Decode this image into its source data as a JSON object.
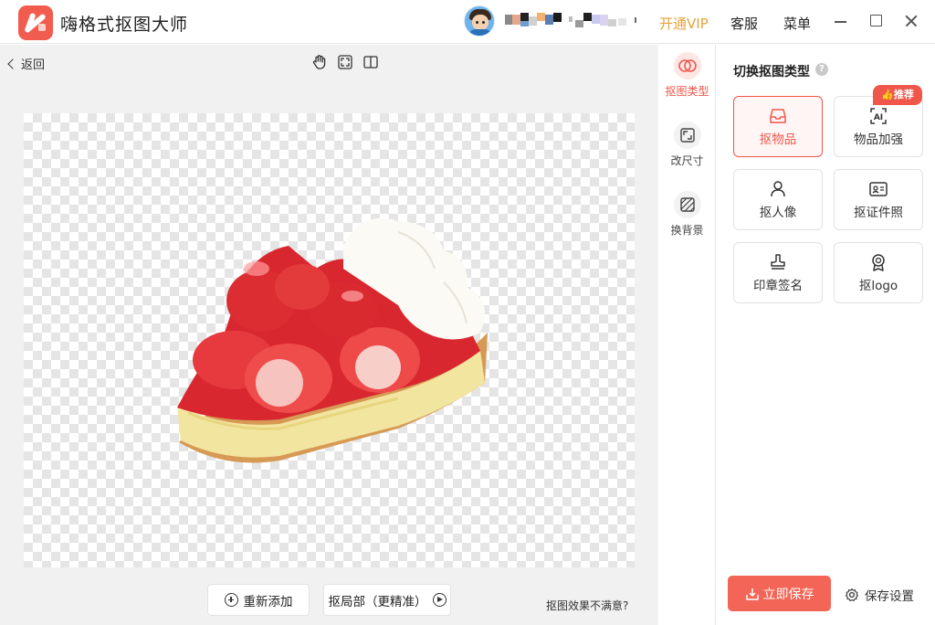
{
  "app": {
    "title": "嗨格式抠图大师"
  },
  "header": {
    "vip_label": "开通VIP",
    "service_label": "客服",
    "menu_label": "菜单",
    "brand_color": "#f25c4f",
    "vip_color": "#e8a23a"
  },
  "toolbar": {
    "back_label": "返回",
    "icons": [
      "hand-icon",
      "fit-screen-icon",
      "compare-icon"
    ]
  },
  "canvas": {
    "readd_label": "重新添加",
    "partial_label": "抠局部（更精准）",
    "unsatisfied_label": "抠图效果不满意?"
  },
  "rail": {
    "items": [
      {
        "label": "抠图类型",
        "icon": "cutout-type-icon",
        "active": true
      },
      {
        "label": "改尺寸",
        "icon": "resize-icon",
        "active": false
      },
      {
        "label": "换背景",
        "icon": "background-icon",
        "active": false
      }
    ]
  },
  "panel": {
    "title": "切换抠图类型",
    "badge": "推荐",
    "cards": [
      {
        "label": "抠物品",
        "icon": "inbox-icon",
        "active": true
      },
      {
        "label": "物品加强",
        "icon": "ai-scan-icon",
        "active": false
      },
      {
        "label": "抠人像",
        "icon": "person-icon",
        "active": false
      },
      {
        "label": "抠证件照",
        "icon": "id-card-icon",
        "active": false
      },
      {
        "label": "印章签名",
        "icon": "stamp-icon",
        "active": false
      },
      {
        "label": "抠logo",
        "icon": "badge-logo-icon",
        "active": false
      }
    ],
    "save_label": "立即保存",
    "settings_label": "保存设置",
    "accent_color": "#f0574b"
  }
}
